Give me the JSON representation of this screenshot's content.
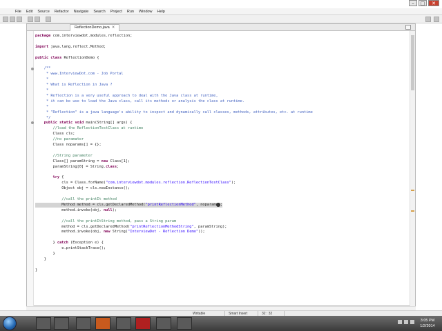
{
  "window": {
    "title": "",
    "controls": [
      "–",
      "□",
      "✕"
    ]
  },
  "menubar": {
    "items": [
      "File",
      "Edit",
      "Source",
      "Refactor",
      "Navigate",
      "Search",
      "Project",
      "Run",
      "Window",
      "Help"
    ]
  },
  "editor": {
    "tab_label": "ReflectionDemo.java",
    "lines": [
      {
        "text": "package com.interviewdot.modules.reflection;"
      },
      {
        "text": ""
      },
      {
        "text": "import java.lang.reflect.Method;"
      },
      {
        "text": ""
      },
      {
        "text": "public class ReflectionDemo {"
      },
      {
        "text": ""
      },
      {
        "text": "    /**"
      },
      {
        "text": "     * www.InterviewDot.com - Job Portal"
      },
      {
        "text": "     *"
      },
      {
        "text": "     * What is Reflection in Java ?"
      },
      {
        "text": "     *"
      },
      {
        "text": "     * Reflection is a very useful approach to deal with the Java class at runtime,"
      },
      {
        "text": "     * it can be use to load the Java class, call its methods or analysis the class at runtime."
      },
      {
        "text": "     *"
      },
      {
        "text": "     * \"Reflection\" is a java language's ability to inspect and dynamically call classes, methods, attributes, etc. at runtime"
      },
      {
        "text": "     */"
      },
      {
        "text": "    public static void main(String[] args) {"
      },
      {
        "text": "        //load the ReflectionTestClass at runtime"
      },
      {
        "text": "        Class cls;"
      },
      {
        "text": "        //no paramater"
      },
      {
        "text": "        Class noparams[] = {};"
      },
      {
        "text": ""
      },
      {
        "text": "        //String parameter"
      },
      {
        "text": "        Class[] paramString = new Class[1];"
      },
      {
        "text": "        paramString[0] = String.class;"
      },
      {
        "text": ""
      },
      {
        "text": "        try {"
      },
      {
        "text": "            cls = Class.forName(\"com.interviewdot.modules.reflection.ReflectionTestClass\");"
      },
      {
        "text": "            Object obj = cls.newInstance();"
      },
      {
        "text": ""
      },
      {
        "text": "            //call the printIt method"
      },
      {
        "text": "            Method method = cls.getDeclaredMethod(\"printReflectionMethod\", noparams);"
      },
      {
        "text": "            method.invoke(obj, null);"
      },
      {
        "text": ""
      },
      {
        "text": "            //call the printItString method, pass a String param"
      },
      {
        "text": "            method = cls.getDeclaredMethod(\"printReflectionMethodString\", paramString);"
      },
      {
        "text": "            method.invoke(obj, new String(\"InterviewDot - Reflection Demo\"));"
      },
      {
        "text": ""
      },
      {
        "text": "        } catch (Exception e) {"
      },
      {
        "text": "            e.printStackTrace();"
      },
      {
        "text": "        }"
      },
      {
        "text": "    }"
      },
      {
        "text": ""
      },
      {
        "text": "}"
      }
    ]
  },
  "statusbar": {
    "segments": [
      "Writable",
      "Smart Insert",
      "32 : 32"
    ]
  },
  "taskbar": {
    "clock_time": "3:05 PM",
    "clock_date": "1/2/2014"
  }
}
